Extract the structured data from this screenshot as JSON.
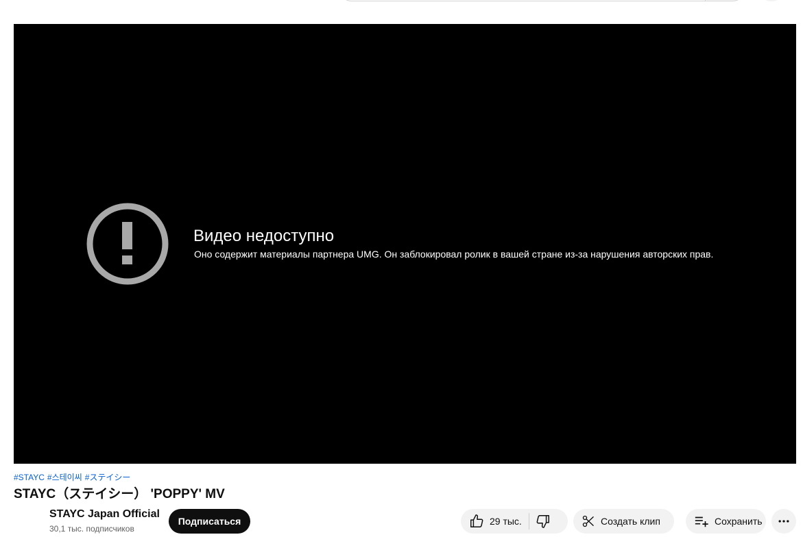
{
  "player": {
    "error_title": "Видео недоступно",
    "error_reason": "Оно содержит материалы партнера UMG. Он заблокировал ролик в вашей стране из-за нарушения авторских прав.",
    "error_icon": "exclamation-circle-icon"
  },
  "video": {
    "hashtags": [
      "#STAYC",
      "#스테이씨",
      "#ステイシー"
    ],
    "title": "STAYC（ステイシー） 'POPPY' MV"
  },
  "channel": {
    "name": "STAYC Japan Official",
    "subscribers": "30,1 тыс. подписчиков",
    "subscribe_label": "Подписаться"
  },
  "actions": {
    "like_count": "29 тыс.",
    "clip_label": "Создать клип",
    "save_label": "Сохранить"
  },
  "colors": {
    "player_bg": "#000000",
    "error_icon": "#a8a8a8",
    "hashtag": "#065fd4",
    "pill_bg": "#f2f2f2",
    "subscribe_bg": "#0f0f0f"
  }
}
